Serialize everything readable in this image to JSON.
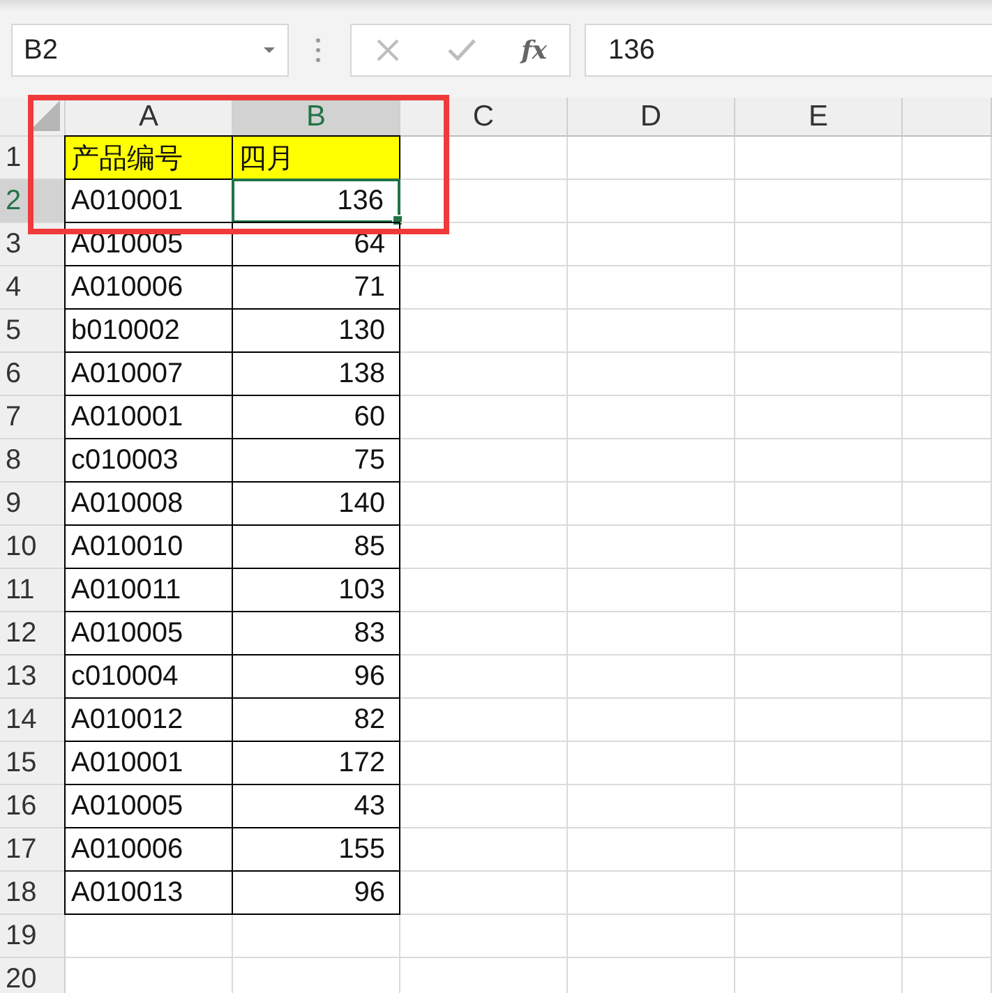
{
  "name_box": {
    "value": "B2"
  },
  "formula_bar": {
    "fx_label": "fx",
    "value": "136"
  },
  "columns": [
    {
      "label": "A",
      "selected": false
    },
    {
      "label": "B",
      "selected": true
    },
    {
      "label": "C",
      "selected": false
    },
    {
      "label": "D",
      "selected": false
    },
    {
      "label": "E",
      "selected": false
    }
  ],
  "rows": [
    {
      "number": "1",
      "selected": false,
      "cells": [
        {
          "text": "产品编号",
          "kind": "text",
          "highlighted": true,
          "selected": false
        },
        {
          "text": "四月",
          "kind": "text",
          "highlighted": true,
          "selected": false
        }
      ]
    },
    {
      "number": "2",
      "selected": true,
      "cells": [
        {
          "text": "A010001",
          "kind": "text",
          "highlighted": false,
          "selected": false
        },
        {
          "text": "136",
          "kind": "number",
          "highlighted": false,
          "selected": true
        }
      ]
    },
    {
      "number": "3",
      "selected": false,
      "cells": [
        {
          "text": "A010005",
          "kind": "text",
          "highlighted": false,
          "selected": false
        },
        {
          "text": "64",
          "kind": "number",
          "highlighted": false,
          "selected": false
        }
      ]
    },
    {
      "number": "4",
      "selected": false,
      "cells": [
        {
          "text": "A010006",
          "kind": "text",
          "highlighted": false,
          "selected": false
        },
        {
          "text": "71",
          "kind": "number",
          "highlighted": false,
          "selected": false
        }
      ]
    },
    {
      "number": "5",
      "selected": false,
      "cells": [
        {
          "text": "b010002",
          "kind": "text",
          "highlighted": false,
          "selected": false
        },
        {
          "text": "130",
          "kind": "number",
          "highlighted": false,
          "selected": false
        }
      ]
    },
    {
      "number": "6",
      "selected": false,
      "cells": [
        {
          "text": "A010007",
          "kind": "text",
          "highlighted": false,
          "selected": false
        },
        {
          "text": "138",
          "kind": "number",
          "highlighted": false,
          "selected": false
        }
      ]
    },
    {
      "number": "7",
      "selected": false,
      "cells": [
        {
          "text": "A010001",
          "kind": "text",
          "highlighted": false,
          "selected": false
        },
        {
          "text": "60",
          "kind": "number",
          "highlighted": false,
          "selected": false
        }
      ]
    },
    {
      "number": "8",
      "selected": false,
      "cells": [
        {
          "text": "c010003",
          "kind": "text",
          "highlighted": false,
          "selected": false
        },
        {
          "text": "75",
          "kind": "number",
          "highlighted": false,
          "selected": false
        }
      ]
    },
    {
      "number": "9",
      "selected": false,
      "cells": [
        {
          "text": "A010008",
          "kind": "text",
          "highlighted": false,
          "selected": false
        },
        {
          "text": "140",
          "kind": "number",
          "highlighted": false,
          "selected": false
        }
      ]
    },
    {
      "number": "10",
      "selected": false,
      "cells": [
        {
          "text": "A010010",
          "kind": "text",
          "highlighted": false,
          "selected": false
        },
        {
          "text": "85",
          "kind": "number",
          "highlighted": false,
          "selected": false
        }
      ]
    },
    {
      "number": "11",
      "selected": false,
      "cells": [
        {
          "text": "A010011",
          "kind": "text",
          "highlighted": false,
          "selected": false
        },
        {
          "text": "103",
          "kind": "number",
          "highlighted": false,
          "selected": false
        }
      ]
    },
    {
      "number": "12",
      "selected": false,
      "cells": [
        {
          "text": "A010005",
          "kind": "text",
          "highlighted": false,
          "selected": false
        },
        {
          "text": "83",
          "kind": "number",
          "highlighted": false,
          "selected": false
        }
      ]
    },
    {
      "number": "13",
      "selected": false,
      "cells": [
        {
          "text": "c010004",
          "kind": "text",
          "highlighted": false,
          "selected": false
        },
        {
          "text": "96",
          "kind": "number",
          "highlighted": false,
          "selected": false
        }
      ]
    },
    {
      "number": "14",
      "selected": false,
      "cells": [
        {
          "text": "A010012",
          "kind": "text",
          "highlighted": false,
          "selected": false
        },
        {
          "text": "82",
          "kind": "number",
          "highlighted": false,
          "selected": false
        }
      ]
    },
    {
      "number": "15",
      "selected": false,
      "cells": [
        {
          "text": "A010001",
          "kind": "text",
          "highlighted": false,
          "selected": false
        },
        {
          "text": "172",
          "kind": "number",
          "highlighted": false,
          "selected": false
        }
      ]
    },
    {
      "number": "16",
      "selected": false,
      "cells": [
        {
          "text": "A010005",
          "kind": "text",
          "highlighted": false,
          "selected": false
        },
        {
          "text": "43",
          "kind": "number",
          "highlighted": false,
          "selected": false
        }
      ]
    },
    {
      "number": "17",
      "selected": false,
      "cells": [
        {
          "text": "A010006",
          "kind": "text",
          "highlighted": false,
          "selected": false
        },
        {
          "text": "155",
          "kind": "number",
          "highlighted": false,
          "selected": false
        }
      ]
    },
    {
      "number": "18",
      "selected": false,
      "cells": [
        {
          "text": "A010013",
          "kind": "text",
          "highlighted": false,
          "selected": false
        },
        {
          "text": "96",
          "kind": "number",
          "highlighted": false,
          "selected": false
        }
      ]
    },
    {
      "number": "19",
      "selected": false
    },
    {
      "number": "20",
      "selected": false
    }
  ],
  "highlight_box": true
}
